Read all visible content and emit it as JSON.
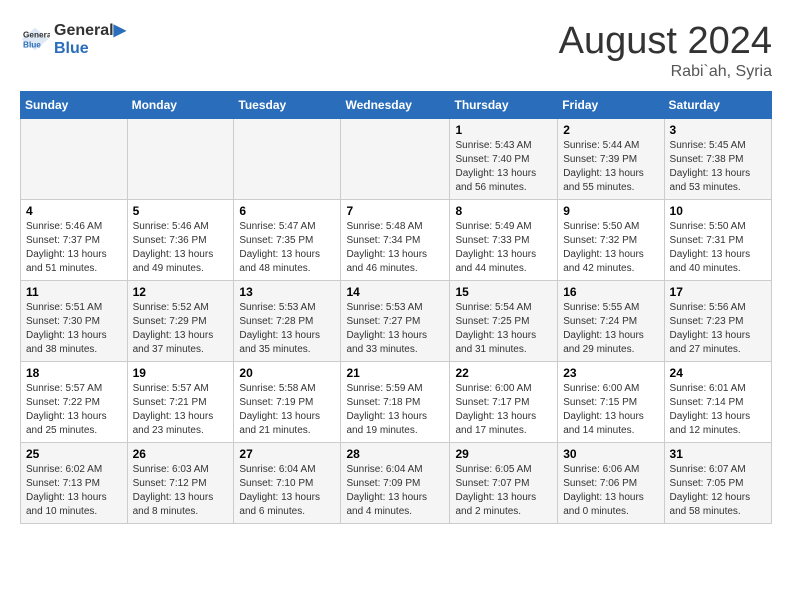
{
  "logo": {
    "line1": "General",
    "line2": "Blue"
  },
  "title": "August 2024",
  "location": "Rabi`ah, Syria",
  "days_header": [
    "Sunday",
    "Monday",
    "Tuesday",
    "Wednesday",
    "Thursday",
    "Friday",
    "Saturday"
  ],
  "weeks": [
    [
      {
        "day": "",
        "content": ""
      },
      {
        "day": "",
        "content": ""
      },
      {
        "day": "",
        "content": ""
      },
      {
        "day": "",
        "content": ""
      },
      {
        "day": "1",
        "content": "Sunrise: 5:43 AM\nSunset: 7:40 PM\nDaylight: 13 hours\nand 56 minutes."
      },
      {
        "day": "2",
        "content": "Sunrise: 5:44 AM\nSunset: 7:39 PM\nDaylight: 13 hours\nand 55 minutes."
      },
      {
        "day": "3",
        "content": "Sunrise: 5:45 AM\nSunset: 7:38 PM\nDaylight: 13 hours\nand 53 minutes."
      }
    ],
    [
      {
        "day": "4",
        "content": "Sunrise: 5:46 AM\nSunset: 7:37 PM\nDaylight: 13 hours\nand 51 minutes."
      },
      {
        "day": "5",
        "content": "Sunrise: 5:46 AM\nSunset: 7:36 PM\nDaylight: 13 hours\nand 49 minutes."
      },
      {
        "day": "6",
        "content": "Sunrise: 5:47 AM\nSunset: 7:35 PM\nDaylight: 13 hours\nand 48 minutes."
      },
      {
        "day": "7",
        "content": "Sunrise: 5:48 AM\nSunset: 7:34 PM\nDaylight: 13 hours\nand 46 minutes."
      },
      {
        "day": "8",
        "content": "Sunrise: 5:49 AM\nSunset: 7:33 PM\nDaylight: 13 hours\nand 44 minutes."
      },
      {
        "day": "9",
        "content": "Sunrise: 5:50 AM\nSunset: 7:32 PM\nDaylight: 13 hours\nand 42 minutes."
      },
      {
        "day": "10",
        "content": "Sunrise: 5:50 AM\nSunset: 7:31 PM\nDaylight: 13 hours\nand 40 minutes."
      }
    ],
    [
      {
        "day": "11",
        "content": "Sunrise: 5:51 AM\nSunset: 7:30 PM\nDaylight: 13 hours\nand 38 minutes."
      },
      {
        "day": "12",
        "content": "Sunrise: 5:52 AM\nSunset: 7:29 PM\nDaylight: 13 hours\nand 37 minutes."
      },
      {
        "day": "13",
        "content": "Sunrise: 5:53 AM\nSunset: 7:28 PM\nDaylight: 13 hours\nand 35 minutes."
      },
      {
        "day": "14",
        "content": "Sunrise: 5:53 AM\nSunset: 7:27 PM\nDaylight: 13 hours\nand 33 minutes."
      },
      {
        "day": "15",
        "content": "Sunrise: 5:54 AM\nSunset: 7:25 PM\nDaylight: 13 hours\nand 31 minutes."
      },
      {
        "day": "16",
        "content": "Sunrise: 5:55 AM\nSunset: 7:24 PM\nDaylight: 13 hours\nand 29 minutes."
      },
      {
        "day": "17",
        "content": "Sunrise: 5:56 AM\nSunset: 7:23 PM\nDaylight: 13 hours\nand 27 minutes."
      }
    ],
    [
      {
        "day": "18",
        "content": "Sunrise: 5:57 AM\nSunset: 7:22 PM\nDaylight: 13 hours\nand 25 minutes."
      },
      {
        "day": "19",
        "content": "Sunrise: 5:57 AM\nSunset: 7:21 PM\nDaylight: 13 hours\nand 23 minutes."
      },
      {
        "day": "20",
        "content": "Sunrise: 5:58 AM\nSunset: 7:19 PM\nDaylight: 13 hours\nand 21 minutes."
      },
      {
        "day": "21",
        "content": "Sunrise: 5:59 AM\nSunset: 7:18 PM\nDaylight: 13 hours\nand 19 minutes."
      },
      {
        "day": "22",
        "content": "Sunrise: 6:00 AM\nSunset: 7:17 PM\nDaylight: 13 hours\nand 17 minutes."
      },
      {
        "day": "23",
        "content": "Sunrise: 6:00 AM\nSunset: 7:15 PM\nDaylight: 13 hours\nand 14 minutes."
      },
      {
        "day": "24",
        "content": "Sunrise: 6:01 AM\nSunset: 7:14 PM\nDaylight: 13 hours\nand 12 minutes."
      }
    ],
    [
      {
        "day": "25",
        "content": "Sunrise: 6:02 AM\nSunset: 7:13 PM\nDaylight: 13 hours\nand 10 minutes."
      },
      {
        "day": "26",
        "content": "Sunrise: 6:03 AM\nSunset: 7:12 PM\nDaylight: 13 hours\nand 8 minutes."
      },
      {
        "day": "27",
        "content": "Sunrise: 6:04 AM\nSunset: 7:10 PM\nDaylight: 13 hours\nand 6 minutes."
      },
      {
        "day": "28",
        "content": "Sunrise: 6:04 AM\nSunset: 7:09 PM\nDaylight: 13 hours\nand 4 minutes."
      },
      {
        "day": "29",
        "content": "Sunrise: 6:05 AM\nSunset: 7:07 PM\nDaylight: 13 hours\nand 2 minutes."
      },
      {
        "day": "30",
        "content": "Sunrise: 6:06 AM\nSunset: 7:06 PM\nDaylight: 13 hours\nand 0 minutes."
      },
      {
        "day": "31",
        "content": "Sunrise: 6:07 AM\nSunset: 7:05 PM\nDaylight: 12 hours\nand 58 minutes."
      }
    ]
  ]
}
